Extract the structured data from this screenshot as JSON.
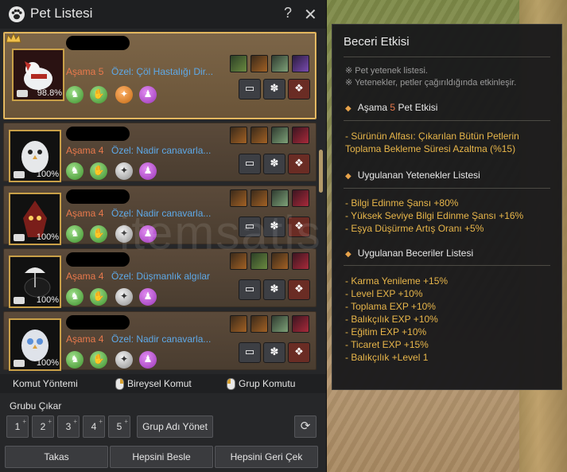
{
  "window": {
    "title": "Pet Listesi",
    "help_label": "?",
    "close_label": "✕"
  },
  "pets": [
    {
      "stage_label": "Aşama",
      "stage_num": "5",
      "special": "Özel: Çöl Hastalığı Dir...",
      "hunger": "98.8%",
      "hunger_percent": 98.8,
      "selected": true
    },
    {
      "stage_label": "Aşama",
      "stage_num": "4",
      "special": "Özel: Nadir canavarla...",
      "hunger": "100%",
      "hunger_percent": 100,
      "selected": false
    },
    {
      "stage_label": "Aşama",
      "stage_num": "4",
      "special": "Özel: Nadir canavarla...",
      "hunger": "100%",
      "hunger_percent": 100,
      "selected": false
    },
    {
      "stage_label": "Aşama",
      "stage_num": "4",
      "special": "Özel: Düşmanlık algılar",
      "hunger": "100%",
      "hunger_percent": 100,
      "selected": false
    },
    {
      "stage_label": "Aşama",
      "stage_num": "4",
      "special": "Özel: Nadir canavarla...",
      "hunger": "100%",
      "hunger_percent": 100,
      "selected": false
    }
  ],
  "command_bar": {
    "mode_label": "Komut Yöntemi",
    "individual_label": "Bireysel Komut",
    "group_label": "Grup Komutu"
  },
  "group": {
    "title": "Grubu Çıkar",
    "slots": [
      "1",
      "2",
      "3",
      "4",
      "5"
    ],
    "manage_label": "Grup Adı Yönet"
  },
  "footer": {
    "exchange_label": "Takas",
    "feed_all_label": "Hepsini Besle",
    "recall_all_label": "Hepsini Geri Çek"
  },
  "tooltip": {
    "title": "Beceri Etkisi",
    "notes": [
      "※ Pet yetenek listesi.",
      "※ Yetenekler, petler çağırıldığında etkinleşir."
    ],
    "tier_header_prefix": "Aşama",
    "tier_header_num": "5",
    "tier_header_suffix": "Pet Etkisi",
    "tier_effect_line1": "- Sürünün Alfası: Çıkarılan Bütün Petlerin",
    "tier_effect_line2": "Toplama Bekleme Süresi Azaltma (%15)",
    "applied_skills_header": "Uygulanan Yetenekler Listesi",
    "applied_skills": [
      "- Bilgi Edinme Şansı +80%",
      "- Yüksek Seviye Bilgi Edinme Şansı +16%",
      "- Eşya Düşürme Artış Oranı +5%"
    ],
    "applied_abilities_header": "Uygulanan Beceriler Listesi",
    "applied_abilities": [
      "- Karma Yenileme +15%",
      "- Level EXP +10%",
      "- Toplama EXP +10%",
      "- Balıkçılık EXP +10%",
      "- Eğitim EXP +10%",
      "- Ticaret EXP +15%",
      "- Balıkçılık +Level 1"
    ]
  },
  "watermark": "itemsatis",
  "colors": {
    "stage_orange": "#e9794c",
    "special_blue": "#5ea9e8",
    "gold": "#e8b64a",
    "panel_bg": "#262729"
  }
}
